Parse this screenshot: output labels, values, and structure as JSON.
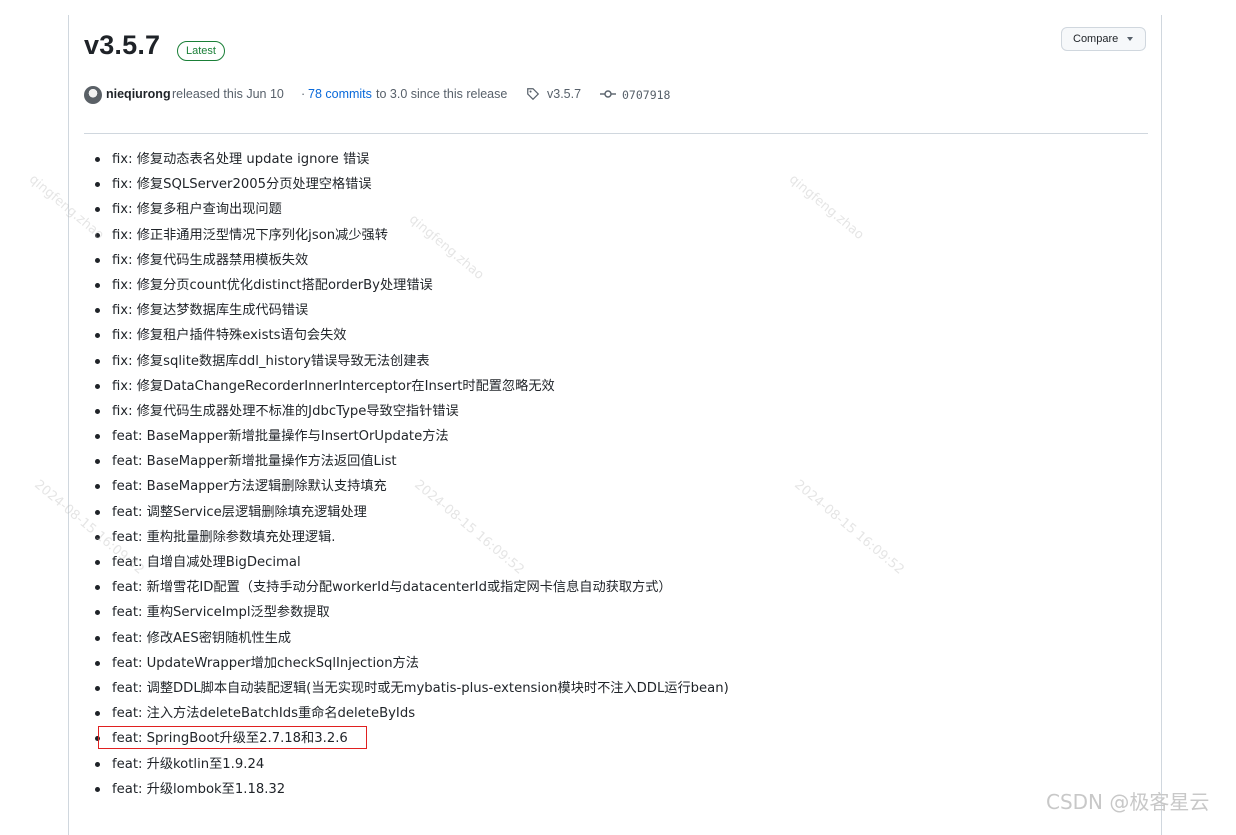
{
  "release": {
    "version": "v3.5.7",
    "badge": "Latest",
    "compare_label": "Compare"
  },
  "meta": {
    "author": "nieqiurong",
    "released_text": "released this Jun 10",
    "separator": "·",
    "commits_link": "78 commits",
    "commits_suffix": "to 3.0 since this release",
    "tag": "v3.5.7",
    "commit_sha": "0707918"
  },
  "notes": [
    "fix: 修复动态表名处理 update ignore 错误",
    "fix: 修复SQLServer2005分页处理空格错误",
    "fix: 修复多租户查询出现问题",
    "fix: 修正非通用泛型情况下序列化json减少强转",
    "fix: 修复代码生成器禁用模板失效",
    "fix: 修复分页count优化distinct搭配orderBy处理错误",
    "fix: 修复达梦数据库生成代码错误",
    "fix: 修复租户插件特殊exists语句会失效",
    "fix: 修复sqlite数据库ddl_history错误导致无法创建表",
    "fix: 修复DataChangeRecorderInnerInterceptor在Insert时配置忽略无效",
    "fix: 修复代码生成器处理不标准的JdbcType导致空指针错误",
    "feat: BaseMapper新增批量操作与InsertOrUpdate方法",
    "feat: BaseMapper新增批量操作方法返回值List",
    "feat: BaseMapper方法逻辑删除默认支持填充",
    "feat: 调整Service层逻辑删除填充逻辑处理",
    "feat: 重构批量删除参数填充处理逻辑.",
    "feat: 自增自减处理BigDecimal",
    "feat: 新增雪花ID配置（支持手动分配workerId与datacenterId或指定网卡信息自动获取方式）",
    "feat: 重构ServiceImpl泛型参数提取",
    "feat: 修改AES密钥随机性生成",
    "feat: UpdateWrapper增加checkSqlInjection方法",
    "feat: 调整DDL脚本自动装配逻辑(当无实现时或无mybatis-plus-extension模块时不注入DDL运行bean)",
    "feat: 注入方法deleteBatchIds重命名deleteByIds",
    "feat: SpringBoot升级至2.7.18和3.2.6",
    "feat: 升级kotlin至1.9.24",
    "feat: 升级lombok至1.18.32"
  ],
  "watermark": {
    "corner": "CSDN @极客星云",
    "diagonal_1": "qingfeng.zhao",
    "diagonal_2": "2024-08-15 16:09:52"
  },
  "colors": {
    "badge_green": "#1a7f37",
    "link_blue": "#0969da",
    "highlight_red": "#e02020"
  },
  "icons": {
    "tag": "tag-icon",
    "commit": "git-commit-icon",
    "compare_caret": "triangle-down-icon"
  }
}
